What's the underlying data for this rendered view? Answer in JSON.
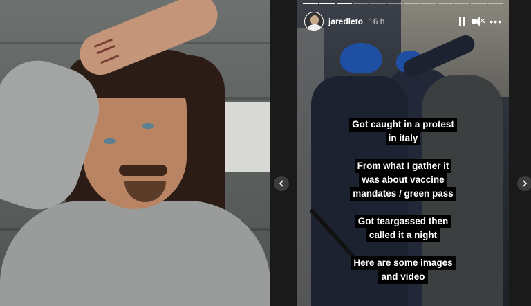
{
  "story": {
    "username": "jaredleto",
    "time": "16 h",
    "progress": {
      "total": 12,
      "current": 3
    },
    "captions": [
      [
        "Got caught in a protest",
        "in italy"
      ],
      [
        "From what I gather it",
        "was about vaccine",
        "mandates / green pass"
      ],
      [
        "Got teargassed then",
        "called it a night"
      ],
      [
        "Here are some images",
        "and video"
      ]
    ]
  },
  "icons": {
    "pause": "pause-icon",
    "mute": "speaker-muted-icon",
    "more": "more-horizontal-icon",
    "prev": "chevron-left-icon",
    "next": "chevron-right-icon"
  },
  "colors": {
    "caption_bg": "#000000",
    "caption_text": "#ffffff",
    "helmet": "#1f4fa3"
  }
}
